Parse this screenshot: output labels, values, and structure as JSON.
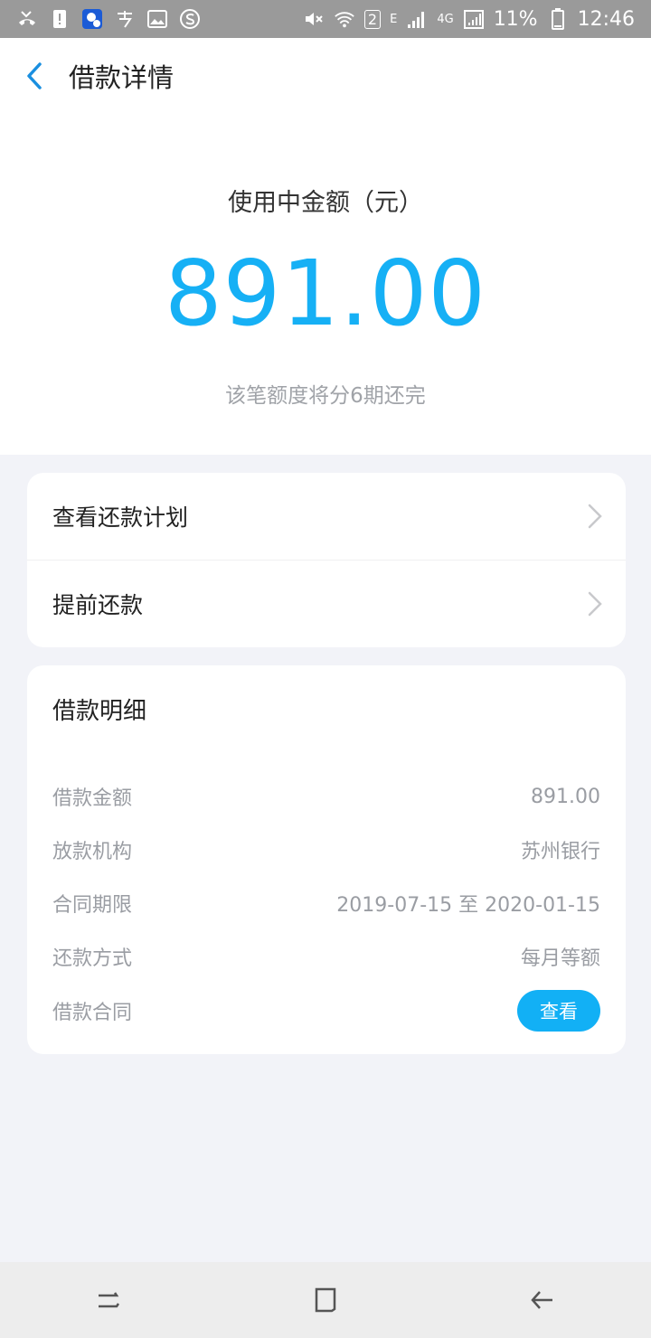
{
  "status_bar": {
    "battery_percent": "11%",
    "time": "12:46",
    "network": "4G",
    "edge": "E",
    "wifi_badge": "2"
  },
  "header": {
    "title": "借款详情"
  },
  "hero": {
    "label": "使用中金额（元）",
    "amount": "891.00",
    "subtitle": "该笔额度将分6期还完"
  },
  "actions": {
    "view_plan": "查看还款计划",
    "prepay": "提前还款"
  },
  "details": {
    "title": "借款明细",
    "rows": [
      {
        "label": "借款金额",
        "value": "891.00"
      },
      {
        "label": "放款机构",
        "value": "苏州银行"
      },
      {
        "label": "合同期限",
        "value": "2019-07-15 至 2020-01-15"
      },
      {
        "label": "还款方式",
        "value": "每月等额"
      },
      {
        "label": "借款合同",
        "button": "查看"
      }
    ]
  },
  "colors": {
    "accent": "#16b0f5",
    "background": "#f2f3f8"
  }
}
